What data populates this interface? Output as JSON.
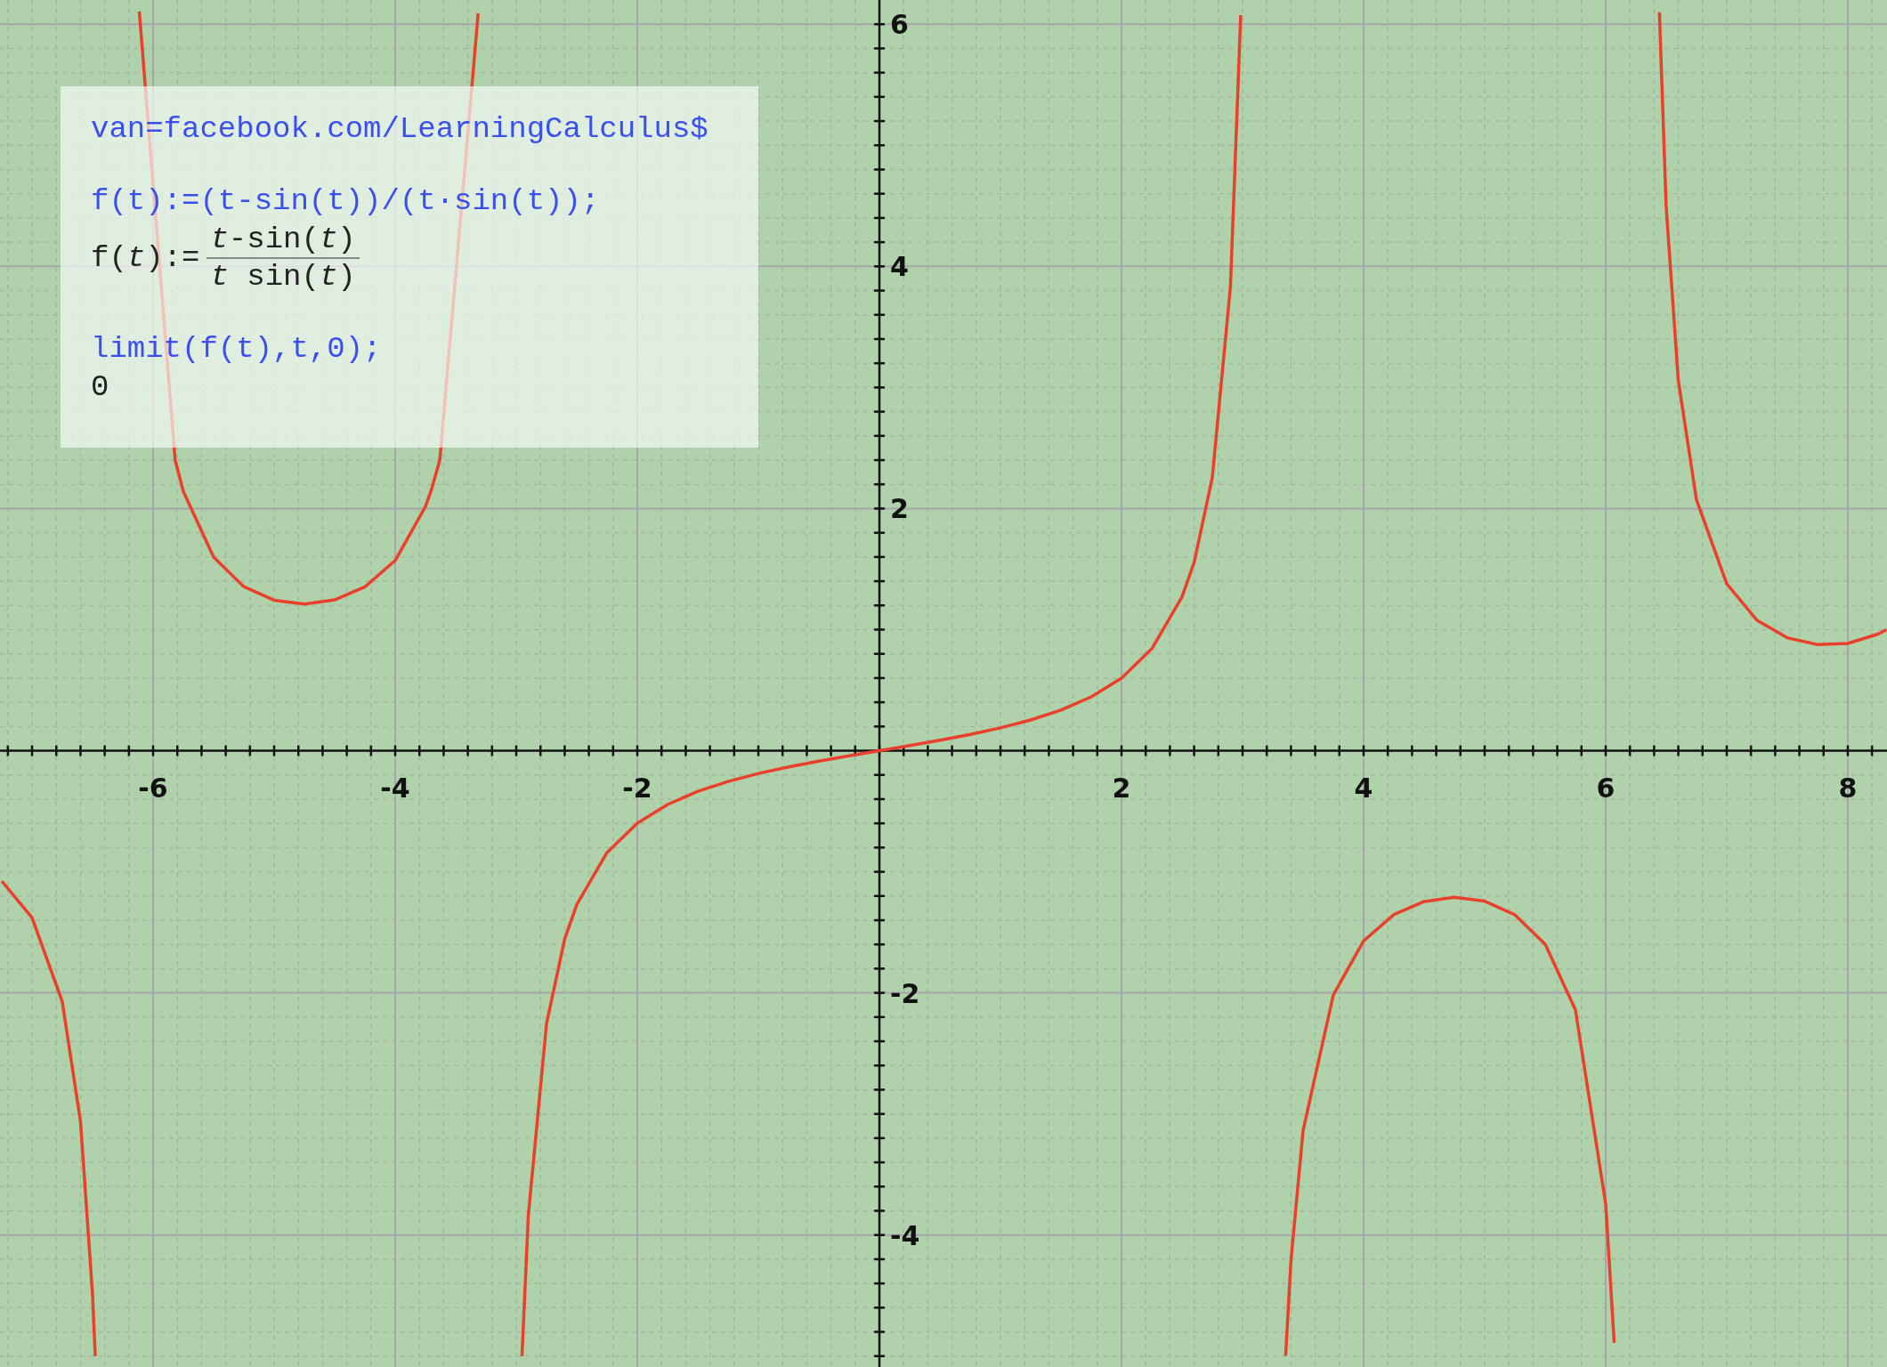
{
  "plot": {
    "chart_data": {
      "type": "line",
      "xlim": [
        -7.265,
        8.324
      ],
      "ylim": [
        -5.09,
        6.2
      ],
      "xticks": [
        -6,
        -4,
        -2,
        2,
        4,
        6,
        8
      ],
      "yticks": [
        -4,
        -2,
        2,
        4,
        6
      ],
      "grid": true,
      "x": [
        -7.25,
        -7,
        -6.75,
        -6.6,
        -6.5,
        -6.478,
        -6.114,
        -5.818,
        -5.75,
        -5.5,
        -5.25,
        -5,
        -4.75,
        -4.5,
        -4.25,
        -4,
        -3.75,
        -3.7,
        -3.632,
        -3.315,
        -2.953,
        -2.9,
        -2.75,
        -2.6,
        -2.5,
        -2.25,
        -2,
        -1.75,
        -1.5,
        -1.25,
        -1,
        -0.75,
        -0.5,
        -0.25,
        0,
        0.25,
        0.5,
        0.75,
        1,
        1.25,
        1.5,
        1.75,
        2,
        2.25,
        2.5,
        2.6,
        2.75,
        2.9,
        2.985,
        3.356,
        3.4,
        3.5,
        3.75,
        4,
        4.25,
        4.5,
        4.75,
        5,
        5.25,
        5.5,
        5.75,
        6,
        6.07,
        6.444,
        6.5,
        6.6,
        6.75,
        7,
        7.25,
        7.5,
        7.75,
        8,
        8.25,
        8.32
      ],
      "series": [
        {
          "color": "#e8402a",
          "values": [
            -1.077,
            -1.379,
            -2.074,
            -3.059,
            -4.495,
            -5.0,
            null,
            null,
            null,
            null,
            null,
            null,
            null,
            null,
            null,
            null,
            null,
            null,
            null,
            null,
            null,
            null,
            null,
            null,
            null,
            null,
            null,
            null,
            null,
            null,
            null,
            null,
            null,
            null,
            null,
            null,
            null,
            null,
            null,
            null,
            null,
            null,
            null,
            null,
            null,
            null,
            null,
            null,
            null,
            null,
            null,
            null,
            null,
            null,
            null,
            null,
            null,
            null,
            null,
            null,
            null,
            null,
            null,
            null,
            null,
            null,
            null,
            null,
            null,
            null,
            null,
            null,
            null,
            null
          ]
        },
        {
          "color": "#e8402a",
          "values": [
            null,
            null,
            null,
            null,
            null,
            null,
            6.105,
            2.4,
            2.141,
            1.599,
            1.355,
            1.243,
            1.211,
            1.245,
            1.353,
            1.571,
            2.016,
            2.158,
            2.4,
            6.09,
            null,
            null,
            null,
            null,
            null,
            null,
            null,
            null,
            null,
            null,
            null,
            null,
            null,
            null,
            null,
            null,
            null,
            null,
            null,
            null,
            null,
            null,
            null,
            null,
            null,
            null,
            null,
            null,
            null,
            null,
            null,
            null,
            null,
            null,
            null,
            null,
            null,
            null,
            null,
            null,
            null,
            null,
            null,
            null,
            null,
            null,
            null,
            null,
            null,
            null,
            null,
            null,
            null,
            null
          ]
        },
        {
          "color": "#e8402a",
          "values": [
            null,
            null,
            null,
            null,
            null,
            null,
            null,
            null,
            null,
            null,
            null,
            null,
            null,
            null,
            null,
            null,
            null,
            null,
            null,
            null,
            -5.0,
            -3.836,
            -2.256,
            -1.555,
            -1.271,
            -0.841,
            -0.6,
            -0.445,
            -0.336,
            -0.254,
            -0.188,
            -0.134,
            -0.086,
            -0.042,
            0,
            0.042,
            0.086,
            0.134,
            0.188,
            0.254,
            0.336,
            0.445,
            0.6,
            0.841,
            1.271,
            1.555,
            2.256,
            3.836,
            6.075,
            null,
            null,
            null,
            null,
            null,
            null,
            null,
            null,
            null,
            null,
            null,
            null,
            null,
            null,
            null,
            null,
            null,
            null,
            null,
            null,
            null,
            null,
            null,
            null,
            null
          ]
        },
        {
          "color": "#e8402a",
          "values": [
            null,
            null,
            null,
            null,
            null,
            null,
            null,
            null,
            null,
            null,
            null,
            null,
            null,
            null,
            null,
            null,
            null,
            null,
            null,
            null,
            null,
            null,
            null,
            null,
            null,
            null,
            null,
            null,
            null,
            null,
            null,
            null,
            null,
            null,
            null,
            null,
            null,
            null,
            null,
            null,
            null,
            null,
            null,
            null,
            null,
            null,
            null,
            null,
            null,
            -4.997,
            -4.208,
            -3.136,
            -2.016,
            -1.571,
            -1.353,
            -1.245,
            -1.211,
            -1.243,
            -1.355,
            -1.599,
            -2.141,
            -3.746,
            -4.891,
            null,
            null,
            null,
            null,
            null,
            null,
            null,
            null,
            null,
            null,
            null
          ]
        },
        {
          "color": "#e8402a",
          "values": [
            null,
            null,
            null,
            null,
            null,
            null,
            null,
            null,
            null,
            null,
            null,
            null,
            null,
            null,
            null,
            null,
            null,
            null,
            null,
            null,
            null,
            null,
            null,
            null,
            null,
            null,
            null,
            null,
            null,
            null,
            null,
            null,
            null,
            null,
            null,
            null,
            null,
            null,
            null,
            null,
            null,
            null,
            null,
            null,
            null,
            null,
            null,
            null,
            null,
            null,
            null,
            null,
            null,
            null,
            null,
            null,
            null,
            null,
            null,
            null,
            null,
            null,
            null,
            6.099,
            4.495,
            3.059,
            2.074,
            1.379,
            1.077,
            0.933,
            0.877,
            0.886,
            0.963,
            0.999
          ]
        }
      ]
    }
  },
  "console": {
    "entries": [
      {
        "kind": "input",
        "text": "van=facebook.com/LearningCalculus$"
      },
      {
        "kind": "input",
        "text": "f(t):=(t-sin(t))/(t·sin(t));"
      },
      {
        "kind": "fraction",
        "lhs": "f(*t*):=",
        "numerator": "*t*-sin(*t*)",
        "denominator": "*t* sin(*t*)"
      },
      {
        "kind": "input",
        "text": "limit(f(t),t,0);"
      },
      {
        "kind": "output",
        "text": "0"
      }
    ]
  }
}
